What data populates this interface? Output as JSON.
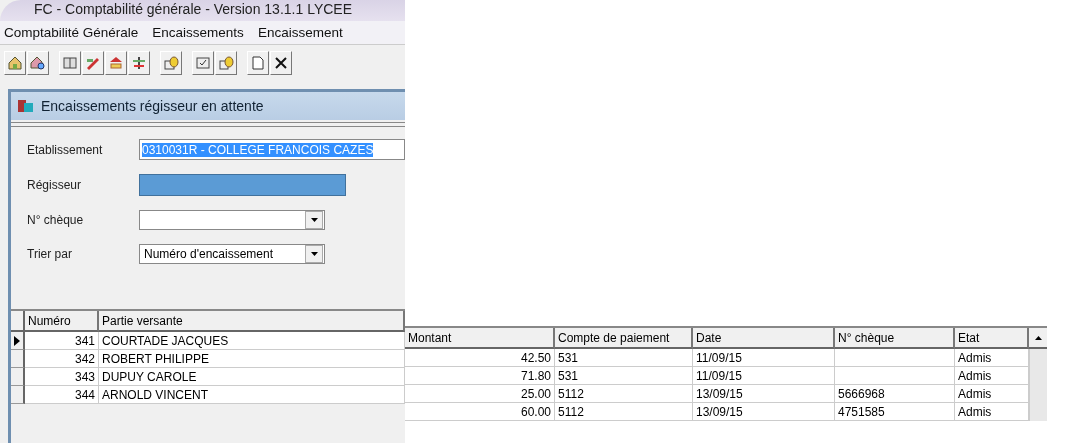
{
  "window": {
    "title": "FC - Comptabilité générale - Version 13.1.1  LYCEE"
  },
  "menu": [
    "Comptabilité Générale",
    "Encaissements",
    "Encaissement"
  ],
  "subwindow": {
    "title": "Encaissements régisseur en attente"
  },
  "form": [
    {
      "kind": "text",
      "label": "Etablissement",
      "value": "0310031R - COLLEGE FRANCOIS CAZES",
      "highlighted": true
    },
    {
      "kind": "redacted",
      "label": "Régisseur"
    },
    {
      "kind": "combo",
      "label": "N° chèque"
    },
    {
      "kind": "combo",
      "label": "Trier par",
      "value": "Numéro d'encaissement"
    }
  ],
  "table": {
    "columns": [
      "Numéro",
      "Partie versante",
      "Montant",
      "Compte de paiement",
      "Date",
      "N° chèque",
      "Etat"
    ],
    "rows": [
      {
        "selected": true,
        "cells": [
          "341",
          "COURTADE JACQUES",
          "42.50",
          "531",
          "11/09/15",
          null,
          "Admis"
        ]
      },
      {
        "selected": false,
        "cells": [
          "342",
          "ROBERT PHILIPPE",
          "71.80",
          "531",
          "11/09/15",
          null,
          "Admis"
        ]
      },
      {
        "selected": false,
        "cells": [
          "343",
          "DUPUY CAROLE",
          "25.00",
          "5112",
          "13/09/15",
          "5666968",
          "Admis"
        ]
      },
      {
        "selected": false,
        "cells": [
          "344",
          "ARNOLD VINCENT",
          "60.00",
          "5112",
          "13/09/15",
          "4751585",
          "Admis"
        ]
      }
    ]
  }
}
